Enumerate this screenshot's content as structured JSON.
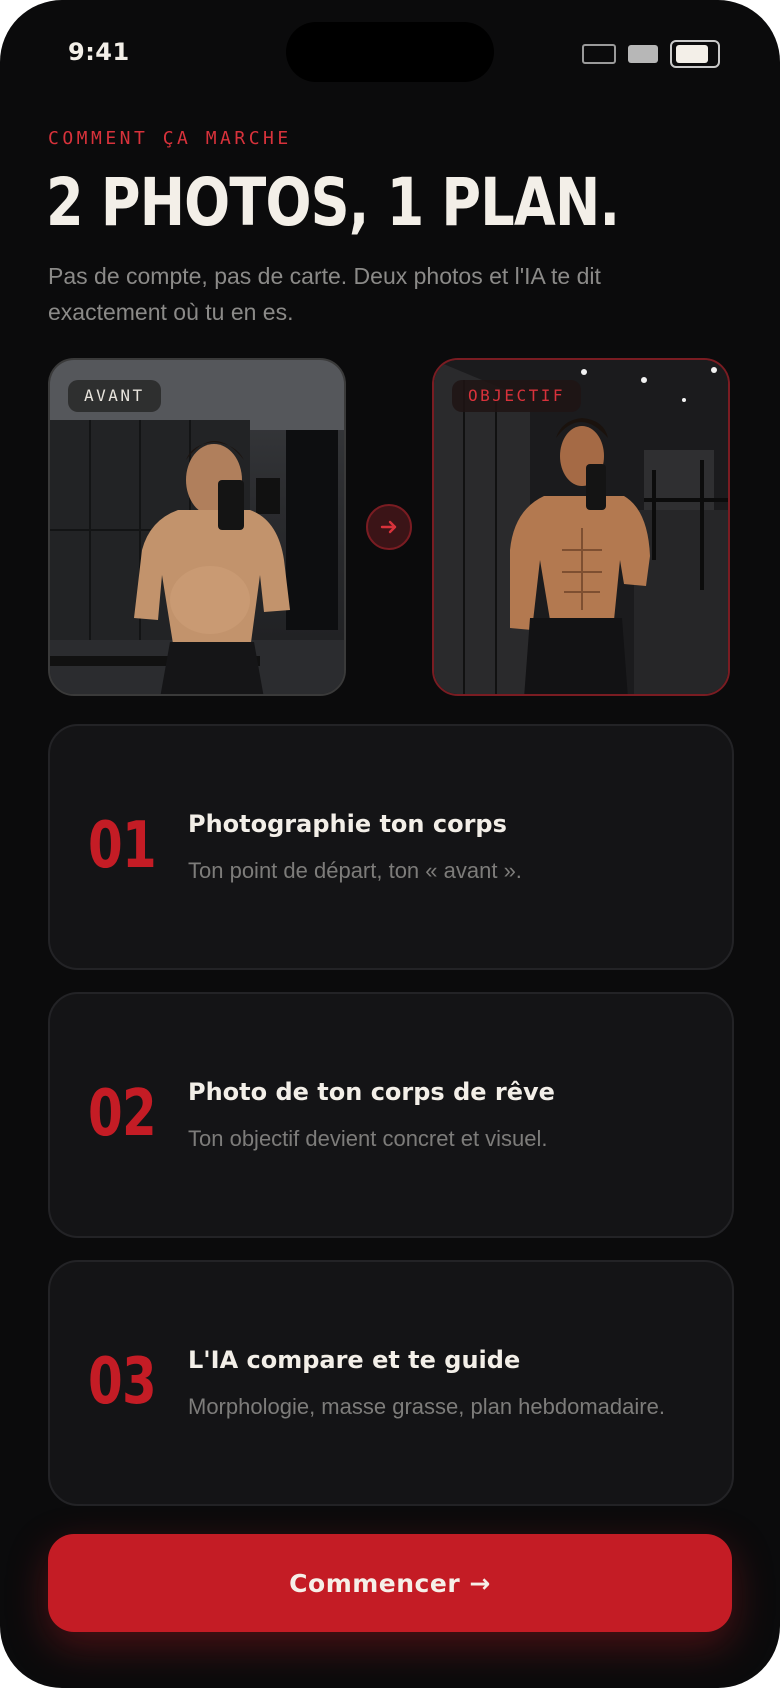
{
  "status_bar": {
    "time": "9:41"
  },
  "intro": {
    "eyebrow": "COMMENT ÇA MARCHE",
    "title": "2 PHOTOS, 1 PLAN.",
    "subtitle": "Pas de compte, pas de carte. Deux photos et l'IA te dit exactement où tu en es."
  },
  "photos": {
    "before_tag": "AVANT",
    "after_tag": "OBJECTIF",
    "arrow_icon": "arrow-right-icon"
  },
  "steps": [
    {
      "number": "01",
      "title": "Photographie ton corps",
      "description": "Ton point de départ, ton « avant »."
    },
    {
      "number": "02",
      "title": "Photo de ton corps de rêve",
      "description": "Ton objectif devient concret et visuel."
    },
    {
      "number": "03",
      "title": "L'IA compare et te guide",
      "description": "Morphologie, masse grasse, plan hebdomadaire."
    }
  ],
  "cta": {
    "label": "Commencer →"
  },
  "colors": {
    "accent": "#c41c25",
    "background": "#0b0b0c",
    "card": "#141416",
    "text": "#f3efe8",
    "muted": "#7d7c7a"
  }
}
